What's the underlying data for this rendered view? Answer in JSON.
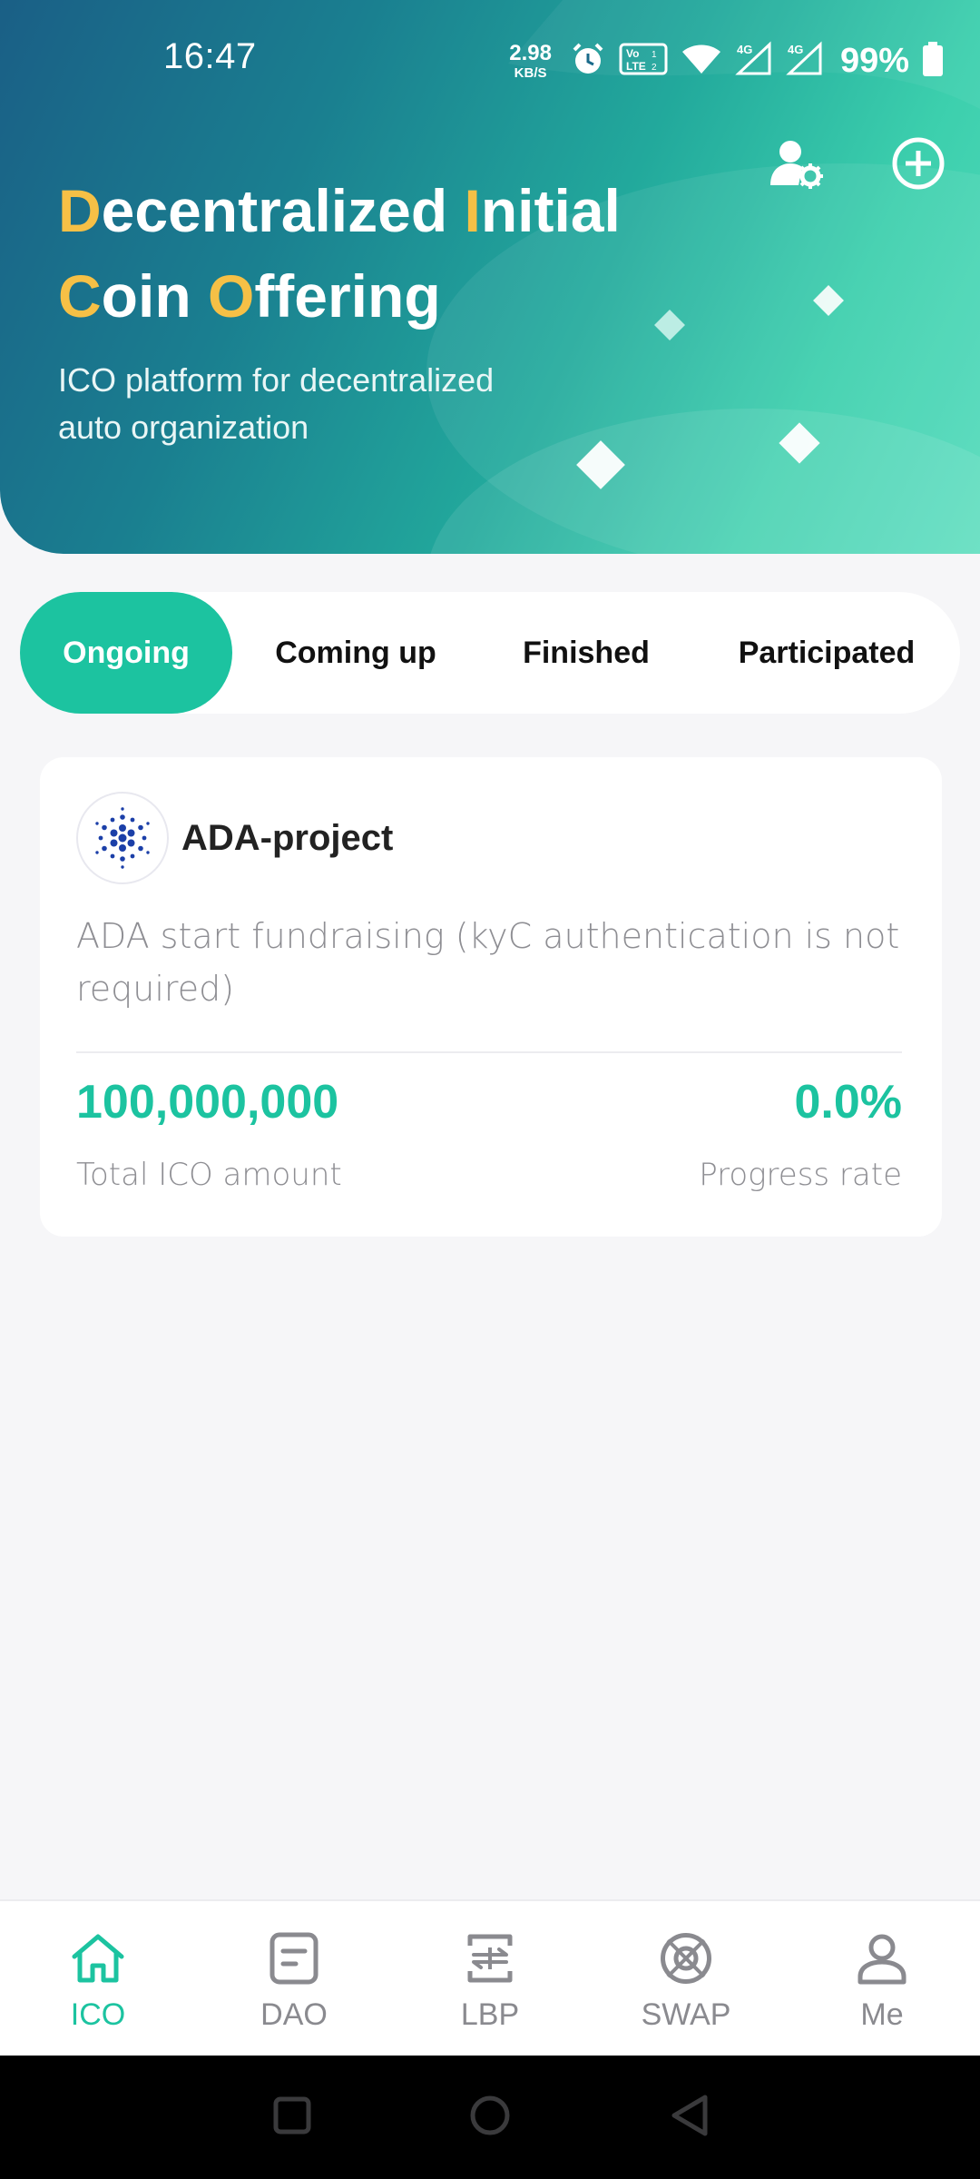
{
  "status_bar": {
    "time": "16:47",
    "net_speed_value": "2.98",
    "net_speed_unit": "KB/S",
    "signal_1_label": "4G",
    "signal_2_label": "4G",
    "volte_label": "Vo LTE",
    "battery_percent": "99%",
    "icons": [
      "alarm-icon",
      "volte-icon",
      "wifi-icon",
      "signal-icon",
      "signal-icon",
      "battery-icon"
    ]
  },
  "hero": {
    "title_parts": [
      {
        "text": "D",
        "highlight": true
      },
      {
        "text": "ecentralized ",
        "highlight": false
      },
      {
        "text": "I",
        "highlight": true
      },
      {
        "text": "nitial",
        "highlight": false
      },
      {
        "text": "C",
        "highlight": true
      },
      {
        "text": "oin ",
        "highlight": false
      },
      {
        "text": "O",
        "highlight": true
      },
      {
        "text": "ffering",
        "highlight": false
      }
    ],
    "subtitle": "ICO platform for decentralized auto organization",
    "actions": [
      "user-settings-icon",
      "add-circle-icon"
    ],
    "highlight_color": "#f6c046"
  },
  "tabs": [
    {
      "label": "Ongoing",
      "active": true
    },
    {
      "label": "Coming up",
      "active": false
    },
    {
      "label": "Finished",
      "active": false
    },
    {
      "label": "Participated",
      "active": false
    }
  ],
  "project": {
    "name": "ADA-project",
    "logo_icon": "cardano-logo-icon",
    "description": "ADA start fundraising (kyC authentication is not required)",
    "total_amount": "100,000,000",
    "total_amount_label": "Total ICO amount",
    "progress_rate": "0.0%",
    "progress_rate_label": "Progress rate"
  },
  "bottom_nav": [
    {
      "label": "ICO",
      "icon": "home-icon",
      "active": true
    },
    {
      "label": "DAO",
      "icon": "document-icon",
      "active": false
    },
    {
      "label": "LBP",
      "icon": "exchange-icon",
      "active": false
    },
    {
      "label": "SWAP",
      "icon": "swap-icon",
      "active": false
    },
    {
      "label": "Me",
      "icon": "profile-icon",
      "active": false
    }
  ],
  "system_nav": [
    "recents-icon",
    "home-circle-icon",
    "back-icon"
  ],
  "colors": {
    "accent": "#1cc3a0",
    "hero_start": "#1a5f86",
    "hero_end": "#55dcbc",
    "text_muted": "#8e8e93",
    "background": "#f6f6f8"
  }
}
